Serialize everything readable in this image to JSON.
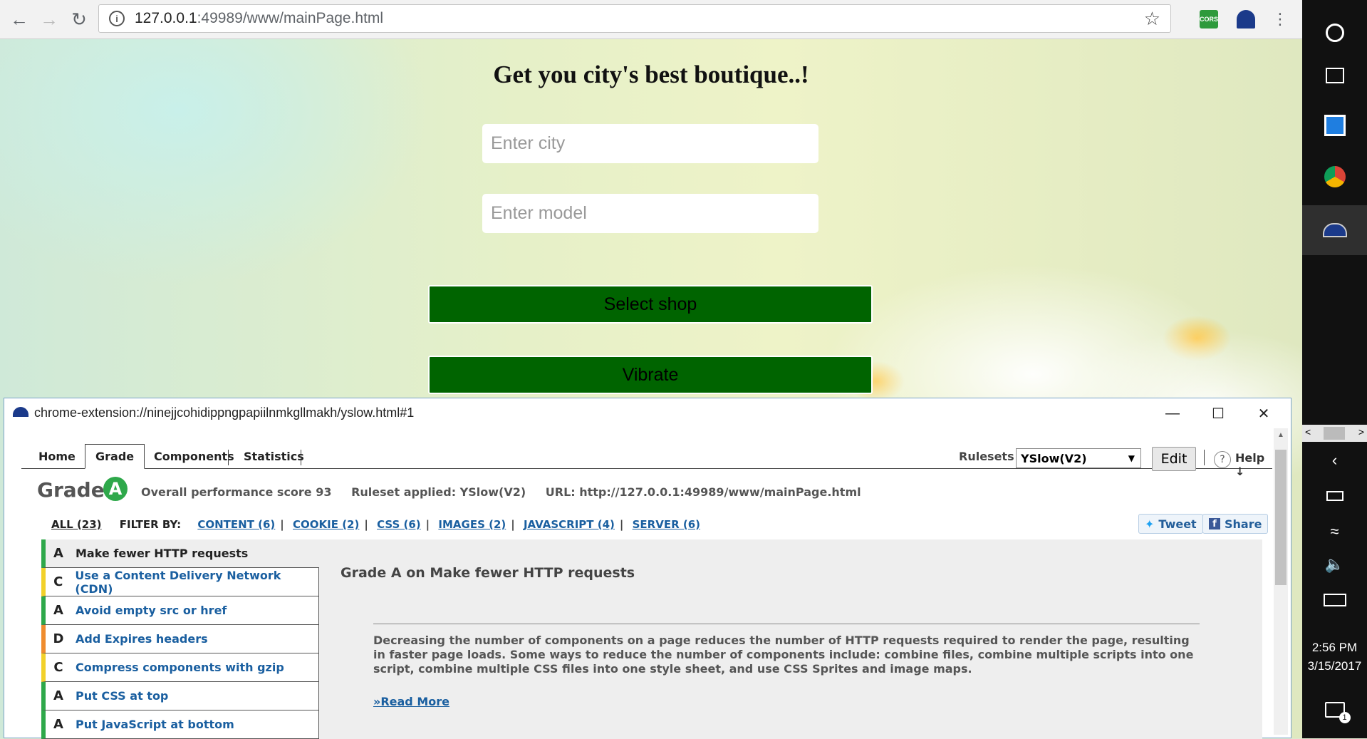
{
  "browser": {
    "url_host": "127.0.0.1",
    "url_rest": ":49989/www/mainPage.html",
    "ext_cors_label": "CORS"
  },
  "page": {
    "headline": "Get you city's best boutique..!",
    "city_placeholder": "Enter city",
    "model_placeholder": "Enter model",
    "select_shop_label": "Select shop",
    "vibrate_label": "Vibrate"
  },
  "yslow": {
    "window_title": "chrome-extension://ninejjcohidippngpapiilnmkgllmakh/yslow.html#1",
    "tabs": [
      "Home",
      "Grade",
      "Components",
      "Statistics"
    ],
    "rulesets_label": "Rulesets",
    "ruleset_value": "YSlow(V2)",
    "edit_label": "Edit",
    "help_label": "Help ↓",
    "grade_label": "Grade",
    "grade_value": "A",
    "overall_score": "Overall performance score 93",
    "ruleset_applied": "Ruleset applied: YSlow(V2)",
    "url_info": "URL: http://127.0.0.1:49989/www/mainPage.html",
    "filter_all": "ALL (23)",
    "filter_by": "FILTER BY:",
    "filters": [
      "CONTENT (6)",
      "COOKIE (2)",
      "CSS (6)",
      "IMAGES (2)",
      "JAVASCRIPT (4)",
      "SERVER (6)"
    ],
    "tweet_label": "Tweet",
    "share_label": "Share",
    "rules": [
      {
        "grade": "A",
        "name": "Make fewer HTTP requests",
        "color": "#2ea84a"
      },
      {
        "grade": "C",
        "name": "Use a Content Delivery Network (CDN)",
        "color": "#f2d12a"
      },
      {
        "grade": "A",
        "name": "Avoid empty src or href",
        "color": "#2ea84a"
      },
      {
        "grade": "D",
        "name": "Add Expires headers",
        "color": "#ef8c2e"
      },
      {
        "grade": "C",
        "name": "Compress components with gzip",
        "color": "#f2d12a"
      },
      {
        "grade": "A",
        "name": "Put CSS at top",
        "color": "#2ea84a"
      },
      {
        "grade": "A",
        "name": "Put JavaScript at bottom",
        "color": "#2ea84a"
      }
    ],
    "detail_title": "Grade A on Make fewer HTTP requests",
    "detail_text": "Decreasing the number of components on a page reduces the number of HTTP requests required to render the page, resulting in faster page loads. Some ways to reduce the number of components include: combine files, combine multiple scripts into one script, combine multiple CSS files into one style sheet, and use CSS Sprites and image maps.",
    "read_more": "»Read More"
  },
  "taskbar": {
    "time": "2:56 PM",
    "date": "3/15/2017",
    "notification_count": "1"
  }
}
